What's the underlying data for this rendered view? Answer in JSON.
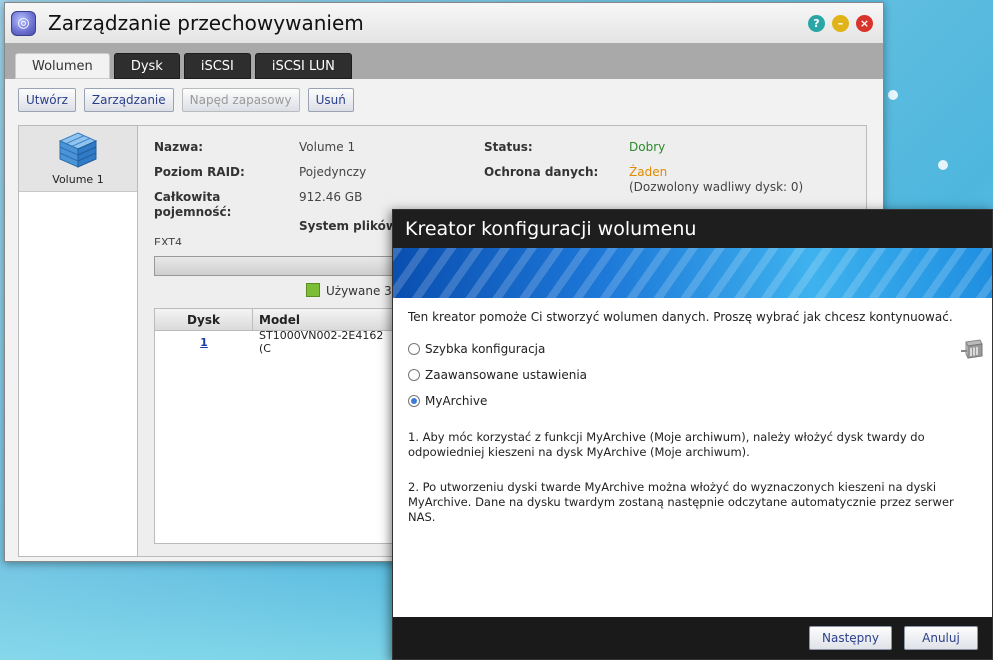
{
  "window": {
    "title": "Zarządzanie przechowywaniem",
    "controls": {
      "help": "?",
      "minimize": "–",
      "close": "×"
    }
  },
  "tabs": [
    {
      "label": "Wolumen",
      "active": true
    },
    {
      "label": "Dysk",
      "active": false
    },
    {
      "label": "iSCSI",
      "active": false
    },
    {
      "label": "iSCSI LUN",
      "active": false
    }
  ],
  "toolbar": {
    "create": "Utwórz",
    "manage": "Zarządzanie",
    "spare": "Napęd zapasowy",
    "delete": "Usuń"
  },
  "volume_list": [
    {
      "label": "Volume 1",
      "icon": "cube-icon"
    }
  ],
  "details": {
    "name_label": "Nazwa:",
    "name_value": "Volume 1",
    "raid_label": "Poziom RAID:",
    "raid_value": "Pojedynczy",
    "capacity_label": "Całkowita pojemność:",
    "capacity_value": "912.46 GB",
    "fs_label": "System plików:",
    "fs_value": "EXT4",
    "status_label": "Status:",
    "status_value": "Dobry",
    "protection_label": "Ochrona danych:",
    "protection_value": "Żaden",
    "protection_note": "(Dozwolony wadliwy dysk: 0)",
    "used_legend": "Używane 3"
  },
  "disk_table": {
    "headers": [
      "Dysk",
      "Model"
    ],
    "rows": [
      {
        "disk": "1",
        "model": "ST1000VN002-2E4162 (C"
      }
    ]
  },
  "wizard": {
    "title": "Kreator konfiguracji wolumenu",
    "intro": "Ten kreator pomoże Ci stworzyć wolumen danych. Proszę wybrać jak chcesz kontynuować.",
    "options": [
      {
        "label": "Szybka konfiguracja",
        "selected": false
      },
      {
        "label": "Zaawansowane ustawienia",
        "selected": false
      },
      {
        "label": "MyArchive",
        "selected": true
      }
    ],
    "note1": "1. Aby móc korzystać z funkcji MyArchive (Moje archiwum), należy włożyć dysk twardy do odpowiedniej kieszeni na dysk MyArchive (Moje archiwum).",
    "note2": "2. Po utworzeniu dyski twarde MyArchive można włożyć do wyznaczonych kieszeni na dyski MyArchive. Dane na dysku twardym zostaną następnie odczytane automatycznie przez serwer NAS.",
    "next": "Następny",
    "cancel": "Anuluj"
  },
  "colors": {
    "status_good": "#2a8a2a",
    "protection_none": "#e08a00",
    "used_green": "#7bbd35"
  }
}
